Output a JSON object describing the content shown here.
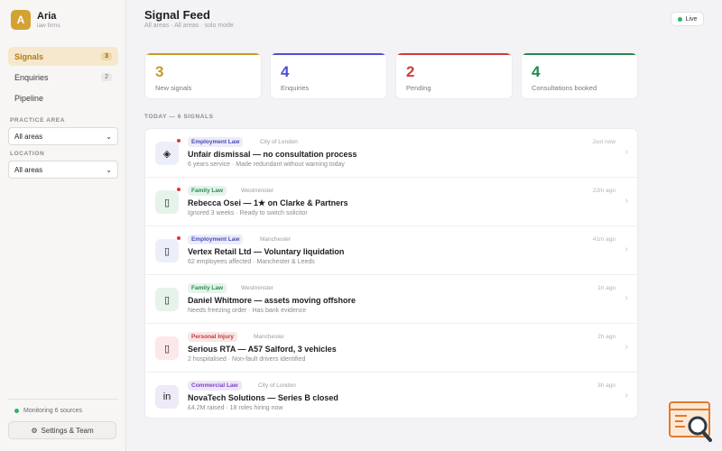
{
  "brand": {
    "logo_letter": "A",
    "name": "Aria",
    "sub": "law firms"
  },
  "nav": [
    {
      "label": "Signals",
      "count": "3",
      "active": true
    },
    {
      "label": "Enquiries",
      "count": "2",
      "active": false
    },
    {
      "label": "Pipeline",
      "count": "",
      "active": false
    }
  ],
  "filters": {
    "practice_area_label": "PRACTICE AREA",
    "practice_area_value": "All areas",
    "location_label": "LOCATION",
    "location_value": "All areas"
  },
  "footer": {
    "monitoring": "Monitoring 6 sources",
    "settings": "Settings & Team",
    "settings_icon": "gear-icon"
  },
  "header": {
    "title": "Signal Feed",
    "subtitle": "All areas · All areas · solo mode",
    "live": "Live"
  },
  "stats": [
    {
      "value": "3",
      "label": "New signals",
      "color": "#c89a2a"
    },
    {
      "value": "4",
      "label": "Enquiries",
      "color": "#4d4fd1"
    },
    {
      "value": "2",
      "label": "Pending",
      "color": "#d23b3b"
    },
    {
      "value": "4",
      "label": "Consultations booked",
      "color": "#1f8a4c"
    }
  ],
  "feed_label": "TODAY — 6 SIGNALS",
  "signals": [
    {
      "tag": "Employment Law",
      "location": "City of London",
      "title": "Unfair dismissal — no consultation process",
      "sub": "6 years service · Made redundant without warning today",
      "time": "Just now",
      "icon": "◈",
      "icon_name": "signal-diamond-icon",
      "unread": true
    },
    {
      "tag": "Family Law",
      "location": "Westminster",
      "title": "Rebecca Osei — 1★ on Clarke & Partners",
      "sub": "Ignored 3 weeks · Ready to switch solicitor",
      "time": "22m ago",
      "icon": "▯",
      "icon_name": "phone-icon",
      "unread": true
    },
    {
      "tag": "Employment Law",
      "location": "Manchester",
      "title": "Vertex Retail Ltd — Voluntary liquidation",
      "sub": "62 employees affected · Manchester & Leeds",
      "time": "41m ago",
      "icon": "▯",
      "icon_name": "phone-icon",
      "unread": true
    },
    {
      "tag": "Family Law",
      "location": "Westminster",
      "title": "Daniel Whitmore — assets moving offshore",
      "sub": "Needs freezing order · Has bank evidence",
      "time": "1h ago",
      "icon": "▯",
      "icon_name": "phone-icon",
      "unread": false
    },
    {
      "tag": "Personal Injury",
      "location": "Manchester",
      "title": "Serious RTA — A57 Salford, 3 vehicles",
      "sub": "2 hospitalised · Non-fault drivers identified",
      "time": "2h ago",
      "icon": "▯",
      "icon_name": "phone-icon",
      "unread": false
    },
    {
      "tag": "Commercial Law",
      "location": "City of London",
      "title": "NovaTech Solutions — Series B closed",
      "sub": "£4.2M raised · 18 roles hiring now",
      "time": "3h ago",
      "icon": "in",
      "icon_name": "linkedin-icon",
      "unread": false
    }
  ]
}
